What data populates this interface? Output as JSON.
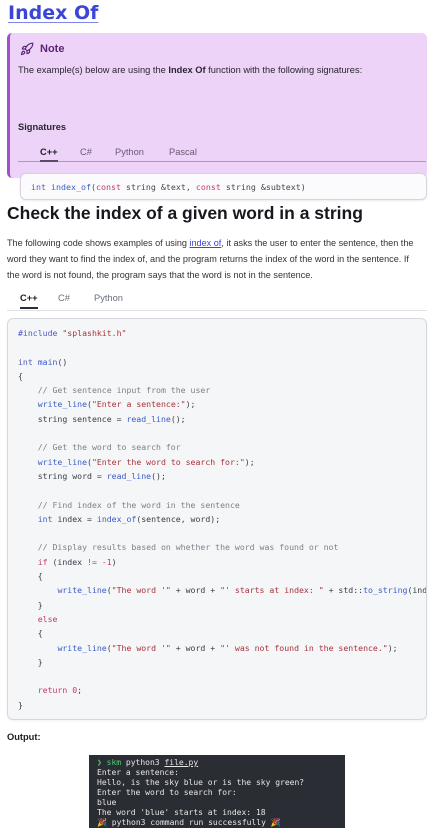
{
  "page": {
    "title": "Index Of"
  },
  "note": {
    "icon": "rocket-icon",
    "title": "Note",
    "text_before": "The example(s) below are using the ",
    "text_bold": "Index Of",
    "text_after": " function with the following signatures:",
    "signatures_label": "Signatures",
    "tabs": [
      "C++",
      "C#",
      "Python",
      "Pascal"
    ],
    "active_tab": "C++",
    "signature": {
      "type1": "int",
      "name": "index_of",
      "open": "(",
      "kw1": "const",
      "arg1": " string &text, ",
      "kw2": "const",
      "arg2": " string &subtext)"
    }
  },
  "section": {
    "heading": "Check the index of a given word in a string",
    "para_before": "The following code shows examples of using ",
    "para_link": "index of",
    "para_after": ", it asks the user to enter the sentence, then the word they want to find the index of, and the program returns the index of the word in the sentence. If the word is not found, the program says that the word is not in the sentence.",
    "tabs": [
      "C++",
      "C#",
      "Python"
    ],
    "active_tab": "C++"
  },
  "code": {
    "l1a": "#include ",
    "l1b": "\"splashkit.h\"",
    "l3a": "int",
    "l3b": " ",
    "l3c": "main",
    "l3d": "()",
    "l4": "{",
    "l5": "    // Get sentence input from the user",
    "l6a": "    ",
    "l6b": "write_line",
    "l6c": "(",
    "l6d": "\"Enter a sentence:\"",
    "l6e": ");",
    "l7a": "    string sentence = ",
    "l7b": "read_line",
    "l7c": "();",
    "l9": "    // Get the word to search for",
    "l10a": "    ",
    "l10b": "write_line",
    "l10c": "(",
    "l10d": "\"Enter the word to search for:\"",
    "l10e": ");",
    "l11a": "    string word = ",
    "l11b": "read_line",
    "l11c": "();",
    "l13": "    // Find index of the word in the sentence",
    "l14a": "    ",
    "l14b": "int",
    "l14c": " index = ",
    "l14d": "index_of",
    "l14e": "(sentence, word);",
    "l16": "    // Display results based on whether the word was found or not",
    "l17a": "    ",
    "l17b": "if",
    "l17c": " (index ",
    "l17d": "!=",
    "l17e": " ",
    "l17f": "-1",
    "l17g": ")",
    "l18": "    {",
    "l19a": "        ",
    "l19b": "write_line",
    "l19c": "(",
    "l19d": "\"The word '\"",
    "l19e": " + word + ",
    "l19f": "\"' starts at index: \"",
    "l19g": " + std::",
    "l19h": "to_string",
    "l19i": "(index));",
    "l20": "    }",
    "l21": "    else",
    "l22": "    {",
    "l23a": "        ",
    "l23b": "write_line",
    "l23c": "(",
    "l23d": "\"The word '\"",
    "l23e": " + word + ",
    "l23f": "\"' was not found in the sentence.\"",
    "l23g": ");",
    "l24": "    }",
    "l26a": "    ",
    "l26b": "return",
    "l26c": " ",
    "l26d": "0",
    "l26e": ";",
    "l27": "}"
  },
  "output": {
    "label": "Output:",
    "prompt": "❯ skm",
    "cmd": " python3 ",
    "file": "file.py",
    "lines": [
      "Enter a sentence:",
      "Hello, is the sky blue or is the sky green?",
      "Enter the word to search for:",
      "blue",
      "The word 'blue' starts at index: 18",
      "🎉  python3 command run successfully 🎉"
    ]
  },
  "colors": {
    "accent": "#3b46d9",
    "note_bg": "#ecd3f7",
    "note_border": "#a04fd0",
    "terminal_bg": "#2a2d34"
  }
}
